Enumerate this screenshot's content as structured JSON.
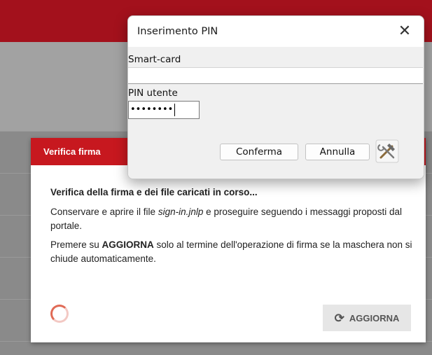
{
  "pin_dialog": {
    "title": "Inserimento PIN",
    "close_glyph": "✕",
    "smartcard_label": "Smart-card",
    "smartcard_value": "",
    "pin_label": "PIN utente",
    "pin_value": "••••••••",
    "confirm_label": "Conferma",
    "cancel_label": "Annulla",
    "tools_icon": "tools-icon"
  },
  "verify_dialog": {
    "title": "Verifica firma",
    "heading": "Verifica della firma e dei file caricati in corso...",
    "para1_before": "Conservare e aprire il file ",
    "para1_file": "sign-in.jnlp",
    "para1_after": " e proseguire seguendo i messaggi proposti dal portale.",
    "para2_before": "Premere su ",
    "para2_bold": "AGGIORNA",
    "para2_after": " solo al termine dell'operazione di firma se la maschera non si chiude automaticamente.",
    "refresh_label": "AGGIORNA",
    "refresh_icon_glyph": "⟳"
  },
  "colors": {
    "header_red": "#a3111c",
    "dialog_red": "#c7181f",
    "spinner_accent": "#e06a55"
  }
}
